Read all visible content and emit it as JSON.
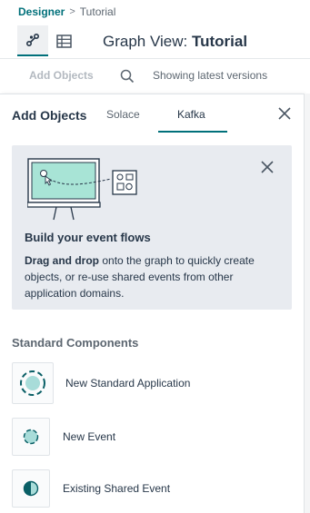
{
  "breadcrumb": {
    "parent": "Designer",
    "separator": ">",
    "current": "Tutorial"
  },
  "view_toggle": {
    "graph_icon": "graph-icon",
    "table_icon": "table-icon"
  },
  "graph_title": {
    "prefix": "Graph View:",
    "name": "Tutorial"
  },
  "toolbar": {
    "add_objects_label": "Add Objects",
    "search_icon": "search-icon",
    "versions_label": "Showing latest versions"
  },
  "panel": {
    "title": "Add Objects",
    "tabs": [
      {
        "label": "Solace"
      },
      {
        "label": "Kafka"
      }
    ],
    "active_tab": "Kafka",
    "info_card": {
      "title": "Build your event flows",
      "text_bold": "Drag and drop",
      "text_rest": " onto the graph to quickly create objects, or re-use shared events from other application domains."
    },
    "section_title": "Standard Components",
    "components": [
      {
        "label": "New Standard Application",
        "icon": "application-icon"
      },
      {
        "label": "New Event",
        "icon": "event-icon"
      },
      {
        "label": "Existing Shared Event",
        "icon": "shared-event-icon"
      }
    ]
  },
  "colors": {
    "accent": "#00707a",
    "card_bg": "#e8ebf0",
    "icon_teal": "#a8dcd9",
    "text": "#273749"
  }
}
